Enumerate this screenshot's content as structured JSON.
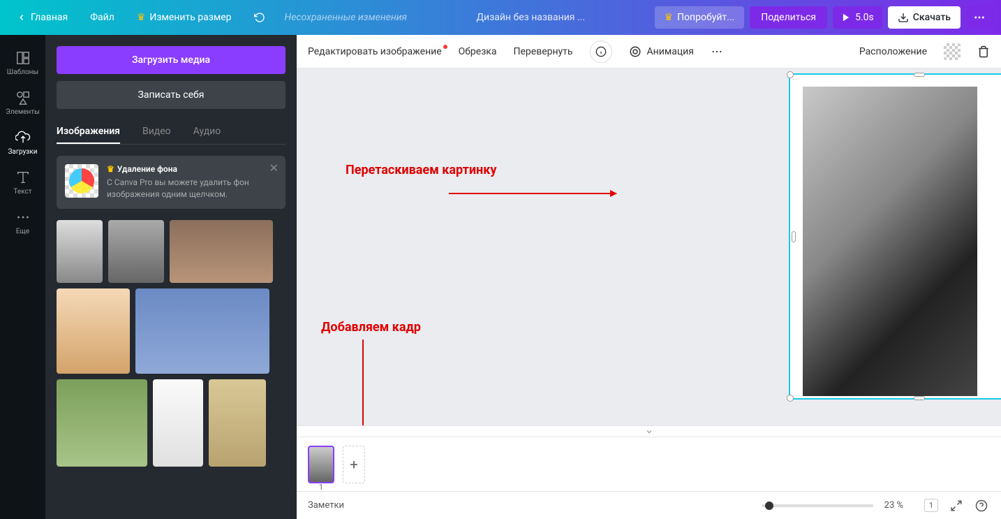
{
  "topbar": {
    "home": "Главная",
    "file": "Файл",
    "resize": "Изменить размер",
    "unsaved": "Несохраненные изменения",
    "design_title": "Дизайн без названия ...",
    "try_pro": "Попробуйт...",
    "share": "Поделиться",
    "duration": "5.0s",
    "download": "Скачать"
  },
  "sidenav": {
    "templates": "Шаблоны",
    "elements": "Элементы",
    "uploads": "Загрузки",
    "text": "Текст",
    "more": "Еще"
  },
  "panel": {
    "upload_media": "Загрузить медиа",
    "record_self": "Записать себя",
    "tabs": {
      "images": "Изображения",
      "video": "Видео",
      "audio": "Аудио"
    },
    "promo": {
      "title": "Удаление фона",
      "desc": "С Canva Pro вы можете удалить фон изображения одним щелчком."
    }
  },
  "context": {
    "edit_image": "Редактировать изображение",
    "crop": "Обрезка",
    "flip": "Перевернуть",
    "animation": "Анимация",
    "position": "Расположение"
  },
  "annotations": {
    "drag_image": "Перетаскиваем картинку",
    "add_frame": "Добавляем кадр"
  },
  "timeline": {
    "page_number": "1"
  },
  "bottombar": {
    "notes": "Заметки",
    "zoom": "23 %",
    "page_count": "1"
  }
}
